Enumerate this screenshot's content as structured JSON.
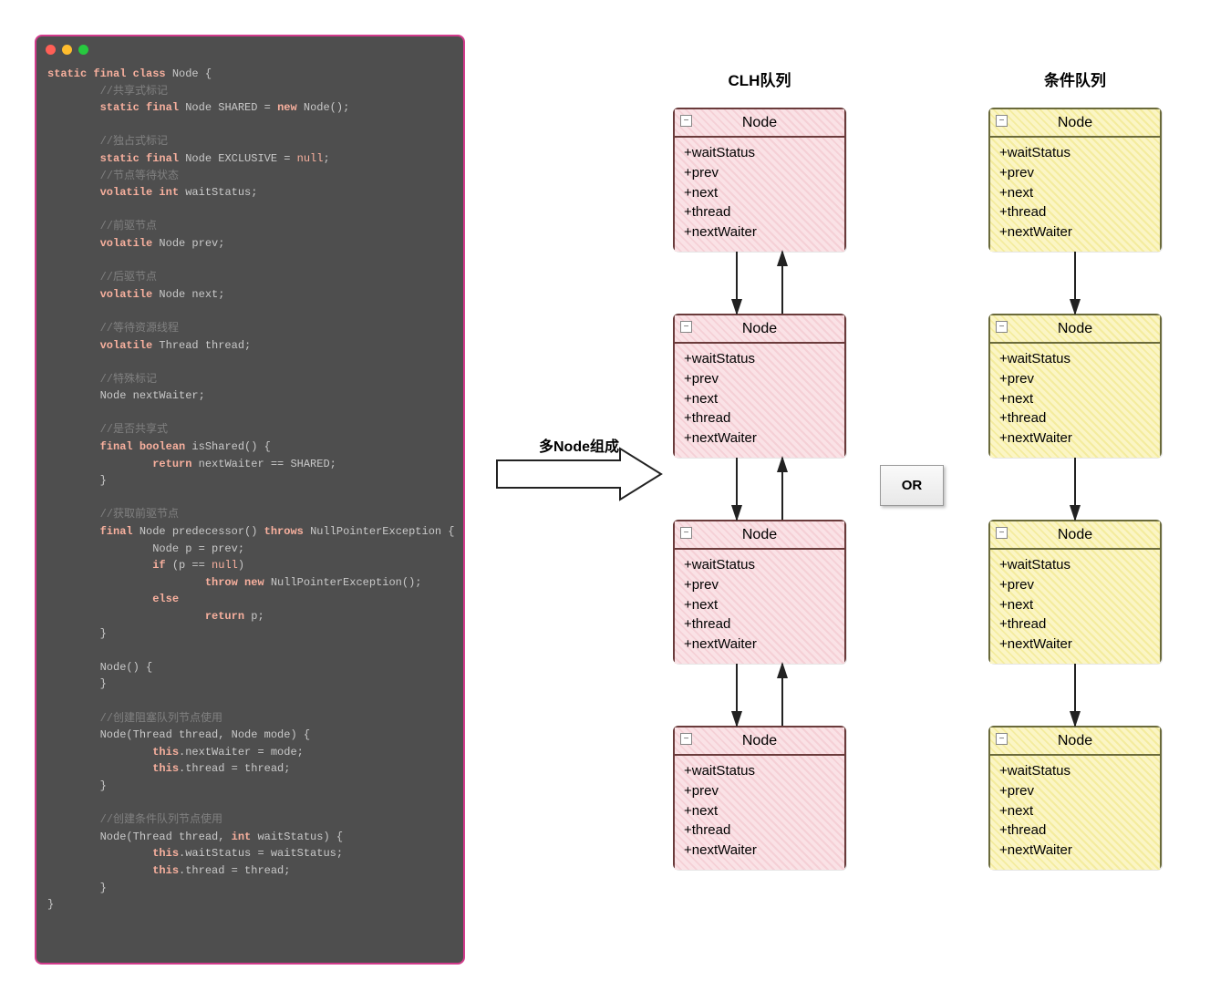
{
  "titles": {
    "clh": "CLH队列",
    "cond": "条件队列",
    "arrow": "多Node组成",
    "or": "OR"
  },
  "node": {
    "name": "Node",
    "fields": [
      "+waitStatus",
      "+prev",
      "+next",
      "+thread",
      "+nextWaiter"
    ]
  },
  "layout": {
    "clhX": 718,
    "condX": 1064,
    "rowsY": [
      98,
      324,
      550,
      776
    ],
    "boxH": 158
  },
  "code": {
    "lines": [
      {
        "indent": 0,
        "tokens": [
          [
            "kw",
            "static final class"
          ],
          [
            "typ",
            " Node {"
          ]
        ]
      },
      {
        "indent": 2,
        "tokens": [
          [
            "cm",
            "//共享式标记"
          ]
        ]
      },
      {
        "indent": 2,
        "tokens": [
          [
            "kw",
            "static final"
          ],
          [
            "typ",
            " Node SHARED = "
          ],
          [
            "kw",
            "new"
          ],
          [
            "typ",
            " Node();"
          ]
        ]
      },
      {
        "blank": true
      },
      {
        "indent": 2,
        "tokens": [
          [
            "cm",
            "//独占式标记"
          ]
        ]
      },
      {
        "indent": 2,
        "tokens": [
          [
            "kw",
            "static final"
          ],
          [
            "typ",
            " Node EXCLUSIVE = "
          ],
          [
            "lit",
            "null"
          ],
          [
            "typ",
            ";"
          ]
        ]
      },
      {
        "indent": 2,
        "tokens": [
          [
            "cm",
            "//节点等待状态"
          ]
        ]
      },
      {
        "indent": 2,
        "tokens": [
          [
            "kw",
            "volatile int"
          ],
          [
            "typ",
            " waitStatus;"
          ]
        ]
      },
      {
        "blank": true
      },
      {
        "indent": 2,
        "tokens": [
          [
            "cm",
            "//前驱节点"
          ]
        ]
      },
      {
        "indent": 2,
        "tokens": [
          [
            "kw",
            "volatile"
          ],
          [
            "typ",
            " Node prev;"
          ]
        ]
      },
      {
        "blank": true
      },
      {
        "indent": 2,
        "tokens": [
          [
            "cm",
            "//后驱节点"
          ]
        ]
      },
      {
        "indent": 2,
        "tokens": [
          [
            "kw",
            "volatile"
          ],
          [
            "typ",
            " Node next;"
          ]
        ]
      },
      {
        "blank": true
      },
      {
        "indent": 2,
        "tokens": [
          [
            "cm",
            "//等待资源线程"
          ]
        ]
      },
      {
        "indent": 2,
        "tokens": [
          [
            "kw",
            "volatile"
          ],
          [
            "typ",
            " Thread thread;"
          ]
        ]
      },
      {
        "blank": true
      },
      {
        "indent": 2,
        "tokens": [
          [
            "cm",
            "//特殊标记"
          ]
        ]
      },
      {
        "indent": 2,
        "tokens": [
          [
            "typ",
            "Node nextWaiter;"
          ]
        ]
      },
      {
        "blank": true
      },
      {
        "indent": 2,
        "tokens": [
          [
            "cm",
            "//是否共享式"
          ]
        ]
      },
      {
        "indent": 2,
        "tokens": [
          [
            "kw",
            "final boolean"
          ],
          [
            "typ",
            " isShared() {"
          ]
        ]
      },
      {
        "indent": 4,
        "tokens": [
          [
            "kw",
            "return"
          ],
          [
            "typ",
            " nextWaiter == SHARED;"
          ]
        ]
      },
      {
        "indent": 2,
        "tokens": [
          [
            "typ",
            "}"
          ]
        ]
      },
      {
        "blank": true
      },
      {
        "indent": 2,
        "tokens": [
          [
            "cm",
            "//获取前驱节点"
          ]
        ]
      },
      {
        "indent": 2,
        "tokens": [
          [
            "kw",
            "final"
          ],
          [
            "typ",
            " Node predecessor() "
          ],
          [
            "kw",
            "throws"
          ],
          [
            "typ",
            " NullPointerException {"
          ]
        ]
      },
      {
        "indent": 4,
        "tokens": [
          [
            "typ",
            "Node p = prev;"
          ]
        ]
      },
      {
        "indent": 4,
        "tokens": [
          [
            "kw",
            "if"
          ],
          [
            "typ",
            " (p == "
          ],
          [
            "lit",
            "null"
          ],
          [
            "typ",
            ")"
          ]
        ]
      },
      {
        "indent": 6,
        "tokens": [
          [
            "kw",
            "throw new"
          ],
          [
            "typ",
            " NullPointerException();"
          ]
        ]
      },
      {
        "indent": 4,
        "tokens": [
          [
            "kw",
            "else"
          ]
        ]
      },
      {
        "indent": 6,
        "tokens": [
          [
            "kw",
            "return"
          ],
          [
            "typ",
            " p;"
          ]
        ]
      },
      {
        "indent": 2,
        "tokens": [
          [
            "typ",
            "}"
          ]
        ]
      },
      {
        "blank": true
      },
      {
        "indent": 2,
        "tokens": [
          [
            "typ",
            "Node() {"
          ]
        ]
      },
      {
        "indent": 2,
        "tokens": [
          [
            "typ",
            "}"
          ]
        ]
      },
      {
        "blank": true
      },
      {
        "indent": 2,
        "tokens": [
          [
            "cm",
            "//创建阻塞队列节点使用"
          ]
        ]
      },
      {
        "indent": 2,
        "tokens": [
          [
            "typ",
            "Node(Thread thread, Node mode) {"
          ]
        ]
      },
      {
        "indent": 4,
        "tokens": [
          [
            "kw",
            "this"
          ],
          [
            "typ",
            ".nextWaiter = mode;"
          ]
        ]
      },
      {
        "indent": 4,
        "tokens": [
          [
            "kw",
            "this"
          ],
          [
            "typ",
            ".thread = thread;"
          ]
        ]
      },
      {
        "indent": 2,
        "tokens": [
          [
            "typ",
            "}"
          ]
        ]
      },
      {
        "blank": true
      },
      {
        "indent": 2,
        "tokens": [
          [
            "cm",
            "//创建条件队列节点使用"
          ]
        ]
      },
      {
        "indent": 2,
        "tokens": [
          [
            "typ",
            "Node(Thread thread, "
          ],
          [
            "kw",
            "int"
          ],
          [
            "typ",
            " waitStatus) {"
          ]
        ]
      },
      {
        "indent": 4,
        "tokens": [
          [
            "kw",
            "this"
          ],
          [
            "typ",
            ".waitStatus = waitStatus;"
          ]
        ]
      },
      {
        "indent": 4,
        "tokens": [
          [
            "kw",
            "this"
          ],
          [
            "typ",
            ".thread = thread;"
          ]
        ]
      },
      {
        "indent": 2,
        "tokens": [
          [
            "typ",
            "}"
          ]
        ]
      },
      {
        "indent": 0,
        "tokens": [
          [
            "typ",
            "}"
          ]
        ]
      }
    ]
  },
  "colors": {
    "pinkBorder": "#6a3b3b",
    "yellowBorder": "#6a6a3b"
  }
}
